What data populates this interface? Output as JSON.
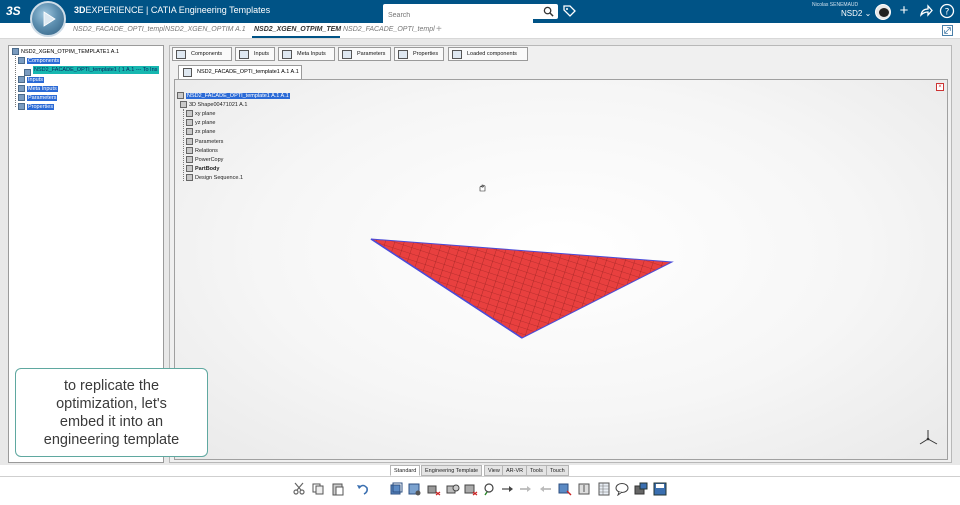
{
  "brand": {
    "ds_logo": "3S",
    "title_bold": "3D",
    "title_rest": "EXPERIENCE | CATIA",
    "title_app": "Engineering Templates"
  },
  "search": {
    "placeholder": "Search"
  },
  "user": {
    "name": "Nicolas SENEMAUD",
    "tenant": "NSD2"
  },
  "doc_tabs": [
    {
      "label": "NSD2_FACADE_OPTI_templ",
      "active": false
    },
    {
      "label": "NSD2_XGEN_OPTIM A.1",
      "active": false
    },
    {
      "label": "NSD2_XGEN_OTPIM_TEM",
      "active": true
    },
    {
      "label": "NSD2_FACADE_OPTI_templ",
      "active": false
    }
  ],
  "left_tree": {
    "root": "NSD2_XGEN_OTPIM_TEMPLATE1 A.1",
    "items": [
      {
        "label": "Components",
        "style": "sel"
      },
      {
        "label": "NSD2_FACADE_OPTI_template1 ( 1 A.1 --- To Ins",
        "style": "sel2"
      },
      {
        "label": "Inputs",
        "style": "sel"
      },
      {
        "label": "Meta Inputs",
        "style": "sel"
      },
      {
        "label": "Parameters",
        "style": "sel"
      },
      {
        "label": "Properties",
        "style": "sel"
      }
    ]
  },
  "panel_tabs": [
    "Components",
    "Inputs",
    "Meta Inputs",
    "Parameters",
    "Properties",
    "Loaded components"
  ],
  "sub_tab": "NSD2_FACADE_OPTI_template1 A.1 A.1",
  "viewport_tree": {
    "root": "NSD2_FACADE_OPTI_template1 A.1 A.1",
    "shape": "3D Shape00471021 A.1",
    "items": [
      "xy plane",
      "yz plane",
      "zx plane",
      "Parameters",
      "Relations",
      "PowerCopy",
      "PartBody",
      "Design Sequence.1"
    ]
  },
  "caption": [
    "to replicate the",
    "optimization, let's",
    "embed it into an",
    "engineering template"
  ],
  "workbench_tabs": [
    "Standard",
    "Engineering Template",
    "View",
    "AR-VR",
    "Tools",
    "Touch"
  ],
  "colors": {
    "brand_blue": "#005386",
    "surface_red": "#e8403f",
    "surface_edge": "#4b4bd8",
    "selection_blue": "#2b6ad6",
    "caption_border": "#5fa8a0"
  },
  "toolbar_icons": [
    "cut-icon",
    "copy-icon",
    "paste-icon",
    "undo-icon",
    "instantiate-icon",
    "template-icon",
    "component-icon",
    "input-icon",
    "check-icon",
    "connect-icon",
    "link-icon",
    "arrow-icon",
    "publish-icon",
    "export-icon",
    "table-icon",
    "comment-icon",
    "capture-icon",
    "save-icon"
  ]
}
